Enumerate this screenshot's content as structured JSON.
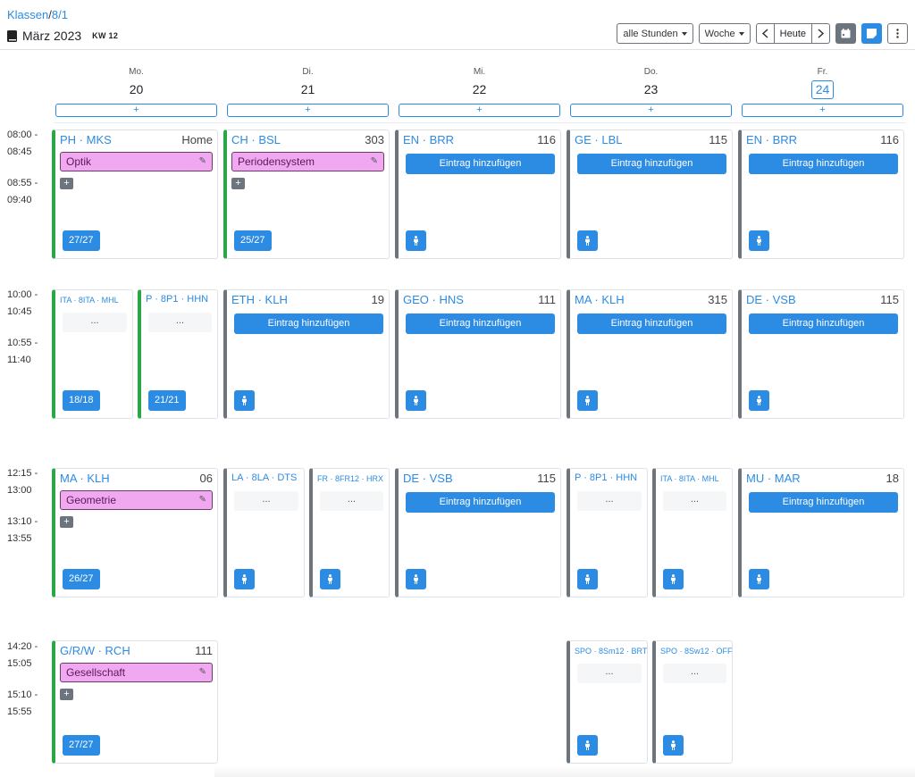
{
  "breadcrumb": {
    "link": "Klassen",
    "sep": "/",
    "current": "8/1"
  },
  "header": {
    "month": "März 2023",
    "week": "KW 12"
  },
  "toolbar": {
    "hours_filter": "alle Stunden",
    "view": "Woche",
    "today": "Heute",
    "prev_icon": "chevron-left-icon",
    "next_icon": "chevron-right-icon",
    "calendar_icon": "calendar-icon",
    "notes_icon": "notes-icon",
    "more_icon": "more-vertical-icon"
  },
  "colors": {
    "accent": "#2c8be3",
    "topic_bg": "#f0a8f0",
    "green": "#28a745",
    "gray": "#6c757d"
  },
  "days": [
    {
      "name": "Mo.",
      "date": "20",
      "add": "+"
    },
    {
      "name": "Di.",
      "date": "21",
      "add": "+"
    },
    {
      "name": "Mi.",
      "date": "22",
      "add": "+"
    },
    {
      "name": "Do.",
      "date": "23",
      "add": "+"
    },
    {
      "name": "Fr.",
      "date": "24",
      "add": "+"
    }
  ],
  "times": [
    [
      "08:00 -",
      "08:45",
      "08:55 -",
      "09:40"
    ],
    [
      "10:00 -",
      "10:45",
      "10:55 -",
      "11:40"
    ],
    [
      "12:15 -",
      "13:00",
      "13:10 -",
      "13:55"
    ],
    [
      "14:20 -",
      "15:05",
      "15:10 -",
      "15:55"
    ]
  ],
  "labels": {
    "entry": "Eintrag hinzufügen",
    "dots": "...",
    "plus": "+"
  },
  "cards": [
    {
      "subject": "PH · MKS",
      "room": "Home",
      "topic": "Optik",
      "count": "27/27"
    },
    {
      "subject": "CH · BSL",
      "room": "303",
      "topic": "Periodensystem",
      "count": "25/27"
    },
    {
      "subject": "EN · BRR",
      "room": "116"
    },
    {
      "subject": "GE · LBL",
      "room": "115"
    },
    {
      "subject": "EN · BRR",
      "room": "116"
    },
    {
      "subject": "ITA · 8ITA · MHL",
      "room": "",
      "count": "18/18"
    },
    {
      "subject": "P · 8P1 · HHN",
      "room": "",
      "count": "21/21"
    },
    {
      "subject": "ETH · KLH",
      "room": "19"
    },
    {
      "subject": "GEO · HNS",
      "room": "111"
    },
    {
      "subject": "MA · KLH",
      "room": "315"
    },
    {
      "subject": "DE · VSB",
      "room": "115"
    },
    {
      "subject": "MA · KLH",
      "room": "06",
      "topic": "Geometrie",
      "count": "26/27"
    },
    {
      "subject": "LA · 8LA · DTS",
      "room": ""
    },
    {
      "subject": "FR · 8FR12 · HRX",
      "room": ""
    },
    {
      "subject": "DE · VSB",
      "room": "115"
    },
    {
      "subject": "P · 8P1 · HHN",
      "room": ""
    },
    {
      "subject": "ITA · 8ITA · MHL",
      "room": ""
    },
    {
      "subject": "MU · MAR",
      "room": "18"
    },
    {
      "subject": "G/R/W · RCH",
      "room": "111",
      "topic": "Gesellschaft",
      "count": "27/27"
    },
    {
      "subject": "SPO · 8Sm12 · BRT",
      "room": ""
    },
    {
      "subject": "SPO · 8Sw12 · OFF",
      "room": ""
    }
  ]
}
